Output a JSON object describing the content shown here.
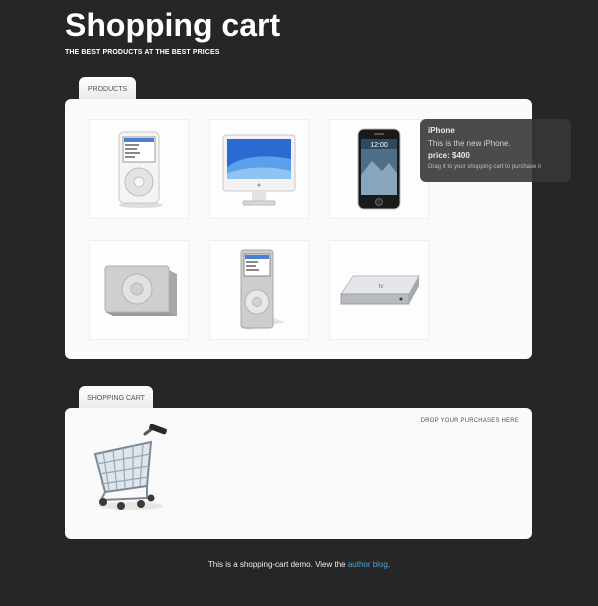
{
  "header": {
    "title": "Shopping cart",
    "subtitle": "THE BEST PRODUCTS AT THE BEST PRICES"
  },
  "products_panel": {
    "tab_label": "PRODUCTS",
    "items": [
      {
        "icon": "ipod-classic-icon"
      },
      {
        "icon": "imac-icon"
      },
      {
        "icon": "iphone-icon"
      },
      {
        "icon": "ipod-shuffle-icon"
      },
      {
        "icon": "ipod-nano-icon"
      },
      {
        "icon": "apple-tv-icon"
      }
    ]
  },
  "tooltip": {
    "name": "iPhone",
    "description": "This is the new iPhone.",
    "price": "price: $400",
    "hint": "Drag it to your shopping cart to purchase it"
  },
  "cart_panel": {
    "tab_label": "SHOPPING CART",
    "drop_hint": "DROP YOUR PURCHASES HERE",
    "icon": "shopping-cart-icon"
  },
  "footer": {
    "text_before": "This is a shopping-cart demo. View the ",
    "link_text": "author blog",
    "text_after": "."
  }
}
